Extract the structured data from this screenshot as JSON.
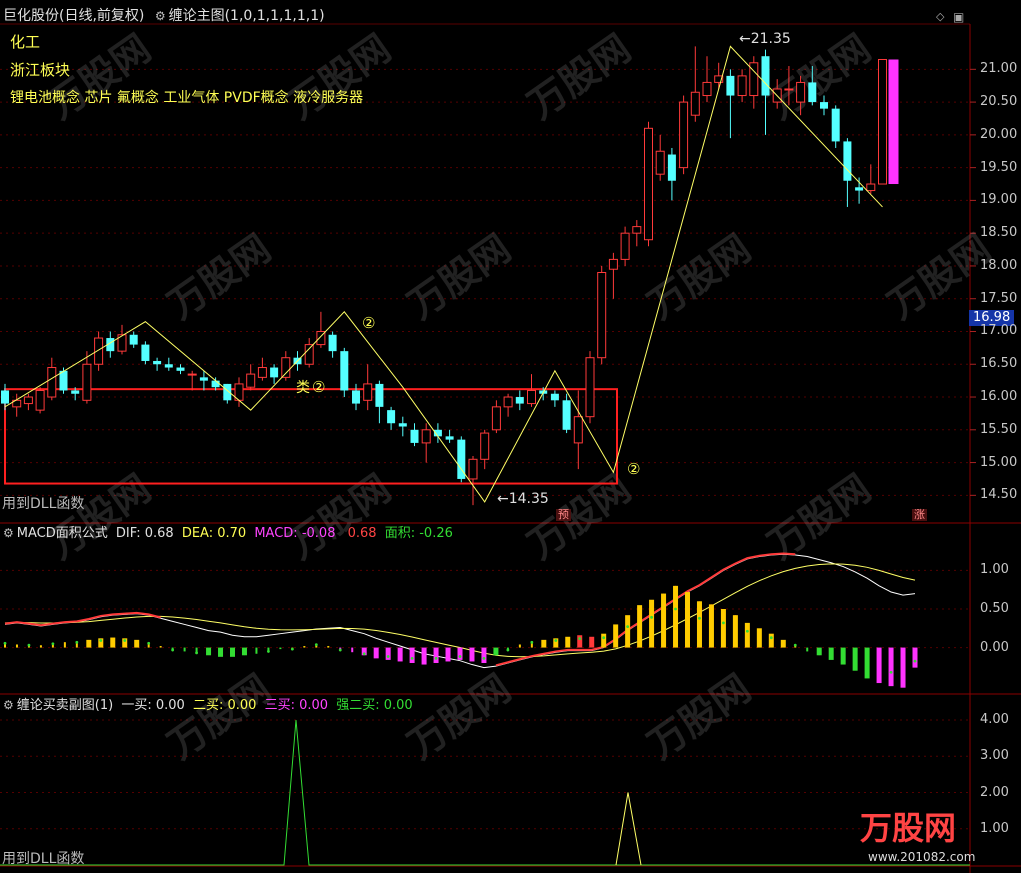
{
  "header": {
    "stock_title": "巨化股份(日线,前复权)",
    "indicator_title": "缠论主图(1,0,1,1,1,1,1)",
    "diamond_icon": "◇",
    "window_icon": "▣"
  },
  "info_lines": {
    "industry": "化工",
    "region": "浙江板块",
    "concepts": "锂电池概念 芯片 氟概念 工业气体 PVDF概念 液冷服务器"
  },
  "annotations": {
    "dll_note_main": "用到DLL函数",
    "dll_note_sub": "用到DLL函数",
    "high_label": "21.35",
    "low_label": "14.35",
    "category_label": "类",
    "circle_marks": [
      "②",
      "②",
      "②"
    ],
    "forecast_tag": "预",
    "rise_tag": "涨",
    "current_price": "16.98"
  },
  "main_axis": {
    "ticks": [
      "21.00",
      "20.50",
      "20.00",
      "19.50",
      "19.00",
      "18.50",
      "18.00",
      "17.50",
      "17.00",
      "16.50",
      "16.00",
      "15.50",
      "15.00",
      "14.50"
    ]
  },
  "macd_panel": {
    "title": "MACD面积公式",
    "dif_label": "DIF:",
    "dif_value": "0.68",
    "dea_label": "DEA:",
    "dea_value": "0.70",
    "macd_label": "MACD:",
    "macd_value": "-0.08",
    "extra_value": "0.68",
    "area_label": "面积:",
    "area_value": "-0.26",
    "ticks": [
      "1.00",
      "0.50",
      "0.00"
    ]
  },
  "sub_panel": {
    "title": "缠论买卖副图(1)",
    "buy1_label": "一买:",
    "buy1_value": "0.00",
    "buy2_label": "二买:",
    "buy2_value": "0.00",
    "buy3_label": "三买:",
    "buy3_value": "0.00",
    "strong2_label": "强二买:",
    "strong2_value": "0.00",
    "ticks": [
      "4.00",
      "3.00",
      "2.00",
      "1.00"
    ]
  },
  "watermark": {
    "brand": "万股网",
    "url": "www.201082.com"
  },
  "colors": {
    "up": "#ff3a3a",
    "down": "#54ffff",
    "zigzag": "#ffff66",
    "box": "#ff2020",
    "magenta": "#ff33ff",
    "green": "#33dd33",
    "yellow": "#ffcc00"
  },
  "chart_data": {
    "type": "candlestick",
    "ylim": [
      14.2,
      21.6
    ],
    "candles": [
      {
        "o": 16.1,
        "c": 15.9,
        "h": 16.2,
        "l": 15.8
      },
      {
        "o": 15.85,
        "c": 15.95,
        "h": 16.05,
        "l": 15.7
      },
      {
        "o": 15.9,
        "c": 16.0,
        "h": 16.05,
        "l": 15.8
      },
      {
        "o": 15.8,
        "c": 16.1,
        "h": 16.15,
        "l": 15.75
      },
      {
        "o": 16.0,
        "c": 16.45,
        "h": 16.6,
        "l": 15.95
      },
      {
        "o": 16.4,
        "c": 16.1,
        "h": 16.45,
        "l": 16.05
      },
      {
        "o": 16.1,
        "c": 16.05,
        "h": 16.15,
        "l": 15.95
      },
      {
        "o": 15.95,
        "c": 16.5,
        "h": 16.7,
        "l": 15.9
      },
      {
        "o": 16.5,
        "c": 16.9,
        "h": 17.0,
        "l": 16.4
      },
      {
        "o": 16.9,
        "c": 16.7,
        "h": 17.0,
        "l": 16.6
      },
      {
        "o": 16.7,
        "c": 16.95,
        "h": 17.1,
        "l": 16.65
      },
      {
        "o": 16.95,
        "c": 16.8,
        "h": 17.0,
        "l": 16.75
      },
      {
        "o": 16.8,
        "c": 16.55,
        "h": 16.85,
        "l": 16.5
      },
      {
        "o": 16.55,
        "c": 16.5,
        "h": 16.6,
        "l": 16.4
      },
      {
        "o": 16.5,
        "c": 16.45,
        "h": 16.6,
        "l": 16.4
      },
      {
        "o": 16.45,
        "c": 16.4,
        "h": 16.5,
        "l": 16.35
      },
      {
        "o": 16.35,
        "c": 16.35,
        "h": 16.4,
        "l": 16.1
      },
      {
        "o": 16.3,
        "c": 16.25,
        "h": 16.4,
        "l": 16.1
      },
      {
        "o": 16.25,
        "c": 16.15,
        "h": 16.3,
        "l": 16.1
      },
      {
        "o": 16.2,
        "c": 15.95,
        "h": 16.2,
        "l": 15.9
      },
      {
        "o": 15.95,
        "c": 16.2,
        "h": 16.3,
        "l": 15.85
      },
      {
        "o": 16.15,
        "c": 16.35,
        "h": 16.5,
        "l": 16.1
      },
      {
        "o": 16.3,
        "c": 16.45,
        "h": 16.6,
        "l": 16.25
      },
      {
        "o": 16.45,
        "c": 16.3,
        "h": 16.5,
        "l": 16.2
      },
      {
        "o": 16.3,
        "c": 16.6,
        "h": 16.7,
        "l": 16.25
      },
      {
        "o": 16.6,
        "c": 16.5,
        "h": 16.7,
        "l": 16.4
      },
      {
        "o": 16.5,
        "c": 16.8,
        "h": 16.9,
        "l": 16.45
      },
      {
        "o": 16.8,
        "c": 17.0,
        "h": 17.3,
        "l": 16.75
      },
      {
        "o": 16.95,
        "c": 16.7,
        "h": 17.0,
        "l": 16.6
      },
      {
        "o": 16.7,
        "c": 16.1,
        "h": 16.75,
        "l": 16.0
      },
      {
        "o": 16.1,
        "c": 15.9,
        "h": 16.2,
        "l": 15.8
      },
      {
        "o": 15.95,
        "c": 16.2,
        "h": 16.5,
        "l": 15.8
      },
      {
        "o": 16.2,
        "c": 15.85,
        "h": 16.25,
        "l": 15.6
      },
      {
        "o": 15.8,
        "c": 15.6,
        "h": 15.85,
        "l": 15.5
      },
      {
        "o": 15.6,
        "c": 15.55,
        "h": 15.7,
        "l": 15.4
      },
      {
        "o": 15.5,
        "c": 15.3,
        "h": 15.6,
        "l": 15.25
      },
      {
        "o": 15.3,
        "c": 15.5,
        "h": 15.6,
        "l": 15.0
      },
      {
        "o": 15.5,
        "c": 15.4,
        "h": 15.6,
        "l": 15.3
      },
      {
        "o": 15.4,
        "c": 15.35,
        "h": 15.5,
        "l": 15.3
      },
      {
        "o": 15.35,
        "c": 14.75,
        "h": 15.4,
        "l": 14.7
      },
      {
        "o": 14.75,
        "c": 15.05,
        "h": 15.1,
        "l": 14.35
      },
      {
        "o": 15.05,
        "c": 15.45,
        "h": 15.5,
        "l": 14.9
      },
      {
        "o": 15.5,
        "c": 15.85,
        "h": 15.95,
        "l": 15.45
      },
      {
        "o": 15.85,
        "c": 16.0,
        "h": 16.05,
        "l": 15.7
      },
      {
        "o": 16.0,
        "c": 15.9,
        "h": 16.1,
        "l": 15.8
      },
      {
        "o": 15.9,
        "c": 16.1,
        "h": 16.35,
        "l": 15.85
      },
      {
        "o": 16.1,
        "c": 16.05,
        "h": 16.15,
        "l": 15.95
      },
      {
        "o": 16.05,
        "c": 15.95,
        "h": 16.1,
        "l": 15.85
      },
      {
        "o": 15.95,
        "c": 15.5,
        "h": 16.05,
        "l": 15.45
      },
      {
        "o": 15.3,
        "c": 15.7,
        "h": 16.1,
        "l": 14.9
      },
      {
        "o": 15.7,
        "c": 16.6,
        "h": 16.7,
        "l": 15.6
      },
      {
        "o": 16.6,
        "c": 17.9,
        "h": 18.0,
        "l": 16.5
      },
      {
        "o": 17.95,
        "c": 18.1,
        "h": 18.2,
        "l": 17.5
      },
      {
        "o": 18.1,
        "c": 18.5,
        "h": 18.6,
        "l": 18.0
      },
      {
        "o": 18.5,
        "c": 18.6,
        "h": 18.7,
        "l": 18.3
      },
      {
        "o": 18.4,
        "c": 20.1,
        "h": 20.2,
        "l": 18.3
      },
      {
        "o": 19.4,
        "c": 19.75,
        "h": 20.0,
        "l": 19.3
      },
      {
        "o": 19.7,
        "c": 19.3,
        "h": 19.8,
        "l": 19.0
      },
      {
        "o": 19.5,
        "c": 20.5,
        "h": 20.6,
        "l": 19.4
      },
      {
        "o": 20.3,
        "c": 20.65,
        "h": 21.35,
        "l": 20.2
      },
      {
        "o": 20.6,
        "c": 20.8,
        "h": 21.2,
        "l": 20.5
      },
      {
        "o": 20.8,
        "c": 20.9,
        "h": 21.1,
        "l": 20.7
      },
      {
        "o": 20.9,
        "c": 20.6,
        "h": 21.0,
        "l": 19.95
      },
      {
        "o": 20.6,
        "c": 20.9,
        "h": 21.0,
        "l": 20.5
      },
      {
        "o": 20.6,
        "c": 21.1,
        "h": 21.2,
        "l": 20.4
      },
      {
        "o": 21.2,
        "c": 20.6,
        "h": 21.3,
        "l": 20.0
      },
      {
        "o": 20.5,
        "c": 20.7,
        "h": 20.85,
        "l": 20.4
      },
      {
        "o": 20.7,
        "c": 20.7,
        "h": 21.05,
        "l": 20.45
      },
      {
        "o": 20.5,
        "c": 20.8,
        "h": 20.9,
        "l": 20.3
      },
      {
        "o": 20.8,
        "c": 20.5,
        "h": 21.05,
        "l": 20.45
      },
      {
        "o": 20.5,
        "c": 20.4,
        "h": 20.6,
        "l": 20.3
      },
      {
        "o": 20.4,
        "c": 19.9,
        "h": 20.45,
        "l": 19.8
      },
      {
        "o": 19.9,
        "c": 19.3,
        "h": 19.95,
        "l": 18.9
      },
      {
        "o": 19.2,
        "c": 19.15,
        "h": 19.35,
        "l": 18.95
      },
      {
        "o": 19.15,
        "c": 19.25,
        "h": 19.55,
        "l": 19.1
      },
      {
        "o": 19.25,
        "c": 21.15,
        "h": 21.15,
        "l": 19.25
      }
    ]
  }
}
